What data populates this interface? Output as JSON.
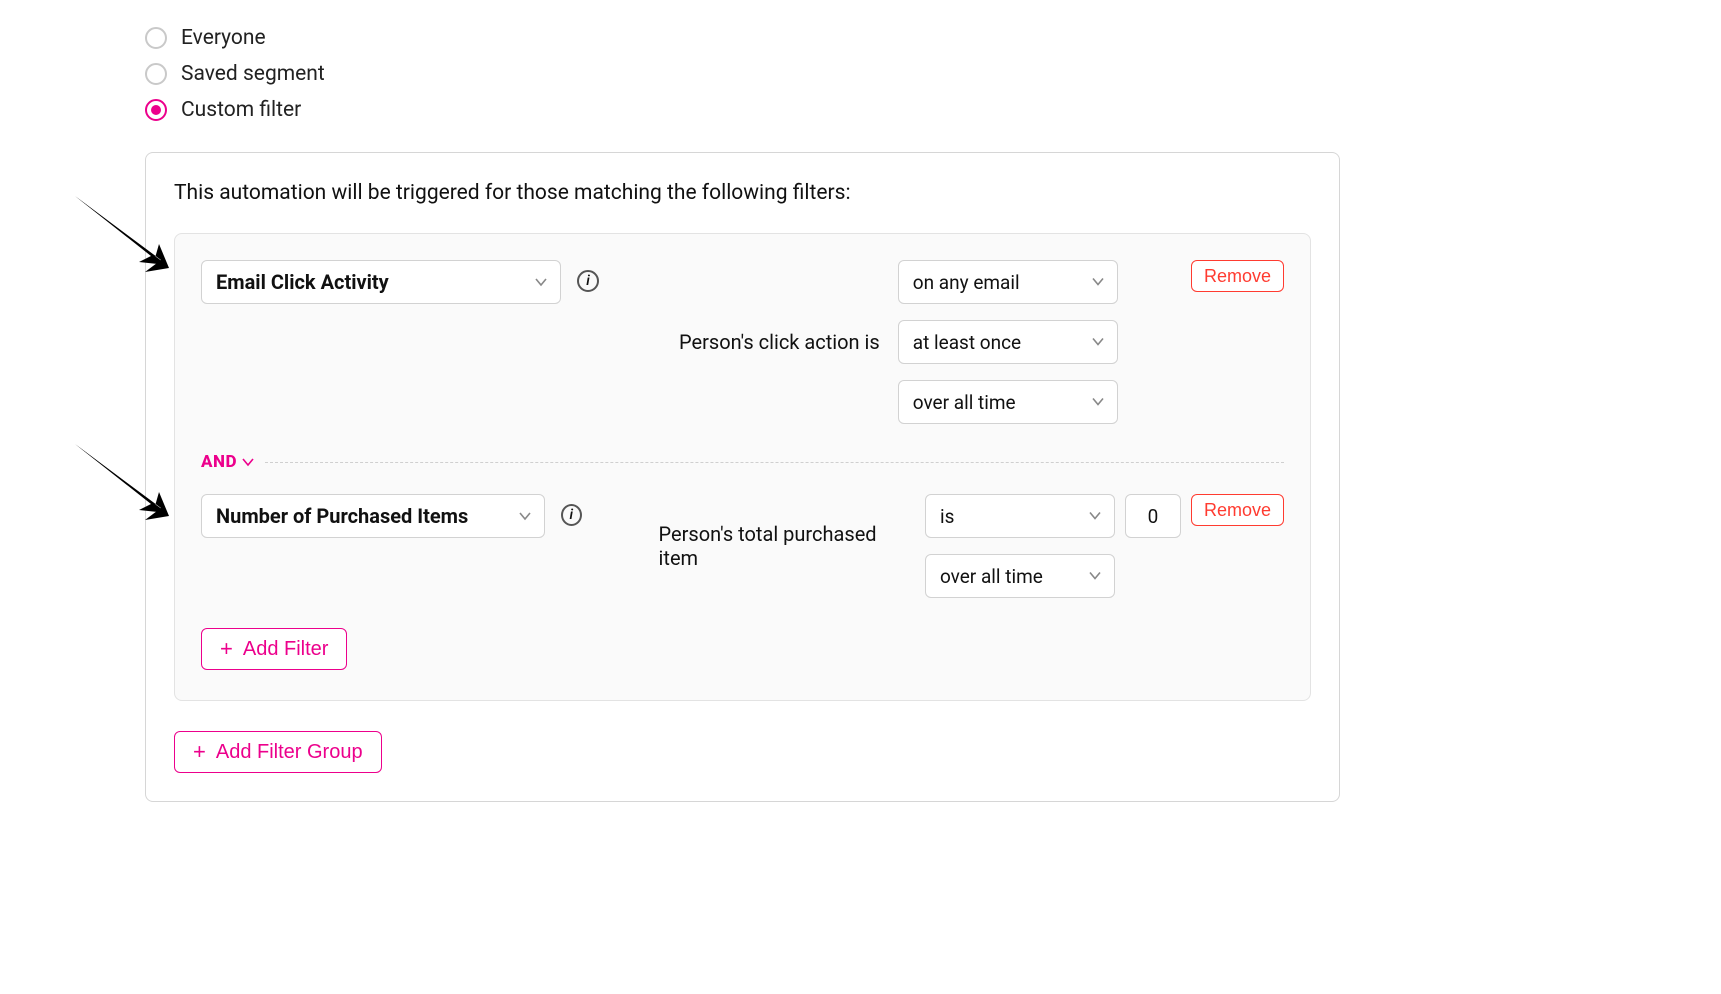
{
  "radios": {
    "r0": "Everyone",
    "r1": "Saved segment",
    "r2": "Custom filter"
  },
  "panel": {
    "description": "This automation will be triggered for those matching the following filters:"
  },
  "combinator": "AND",
  "filter1": {
    "attribute": "Email Click Activity",
    "label": "Person's click action is",
    "select1": "on any email",
    "select2": "at least once",
    "select3": "over all time",
    "remove": "Remove"
  },
  "filter2": {
    "attribute": "Number of Purchased Items",
    "label": "Person's total purchased item",
    "operator": "is",
    "value": "0",
    "select2": "over all time",
    "remove": "Remove"
  },
  "buttons": {
    "addFilter": "Add Filter",
    "addFilterGroup": "Add Filter Group"
  }
}
